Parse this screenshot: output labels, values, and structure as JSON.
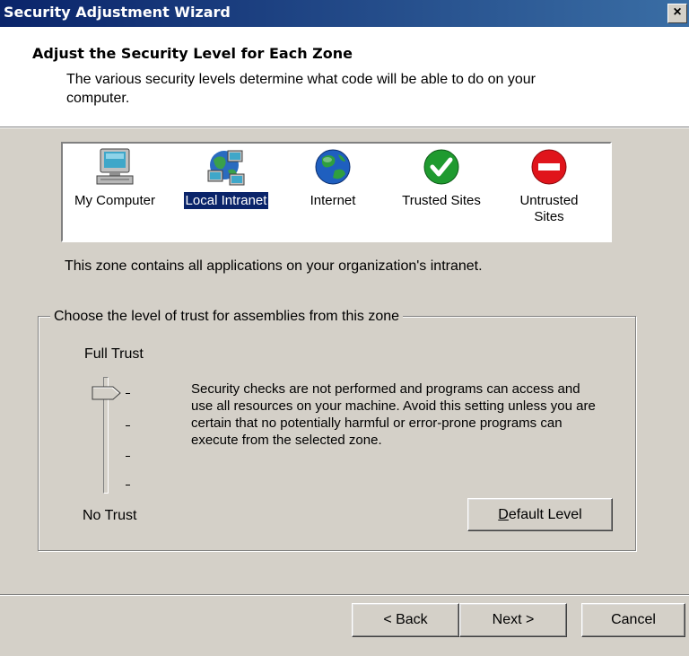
{
  "window": {
    "title": "Security Adjustment Wizard",
    "close_glyph": "×"
  },
  "header": {
    "title": "Adjust the Security Level for Each Zone",
    "description": "The various security levels determine what code will be able to do on your computer."
  },
  "zones": [
    {
      "label": "My Computer",
      "icon": "computer-icon",
      "selected": false
    },
    {
      "label": "Local Intranet",
      "icon": "network-icon",
      "selected": true
    },
    {
      "label": "Internet",
      "icon": "globe-icon",
      "selected": false
    },
    {
      "label": "Trusted Sites",
      "icon": "checkmark-icon",
      "selected": false
    },
    {
      "label": "Untrusted Sites",
      "icon": "no-entry-icon",
      "selected": false
    }
  ],
  "zone_description": "This zone contains all applications on your organization's intranet.",
  "trust": {
    "group_label": "Choose the level of trust for assemblies from this zone",
    "top_label": "Full Trust",
    "bottom_label": "No Trust",
    "level_fraction": 1.0,
    "level_description": "Security checks are not performed and programs can access and use all resources on your machine.  Avoid this setting unless you are certain that no potentially harmful or error-prone programs can execute from the selected zone.",
    "default_button": {
      "label": "Default Level",
      "mnemonic": "D"
    }
  },
  "buttons": {
    "back": "< Back",
    "next": "Next >",
    "cancel": "Cancel"
  },
  "colors": {
    "titlebar_start": "#0a246a",
    "titlebar_end": "#3a6ea5",
    "selection": "#0a246a",
    "face": "#d4d0c8"
  }
}
